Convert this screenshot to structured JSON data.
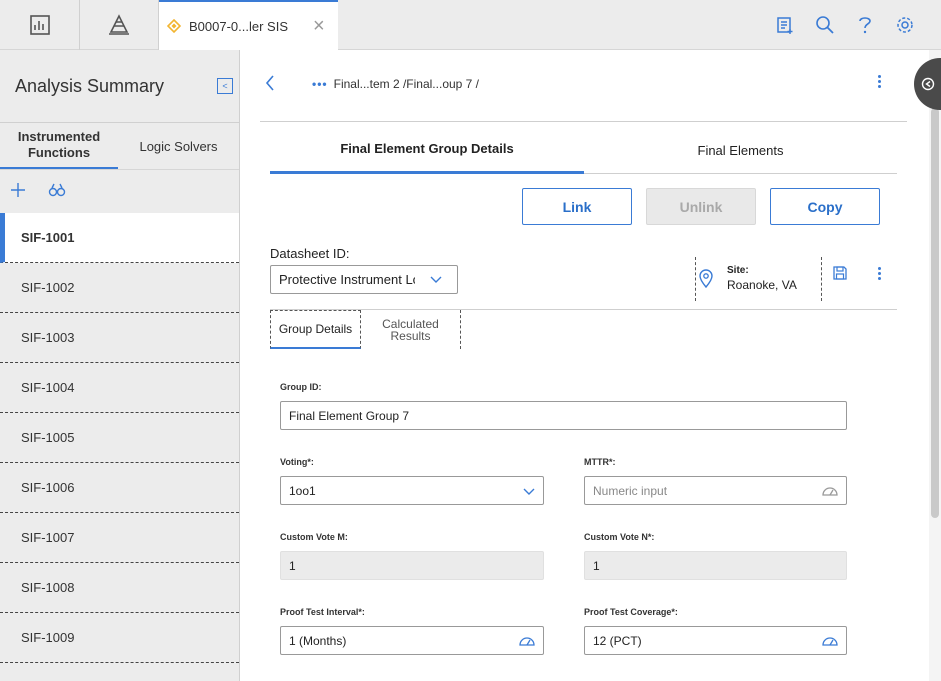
{
  "topbar": {
    "tab_label": "B0007-0...ler SIS",
    "tab_close": "×"
  },
  "left": {
    "title": "Analysis Summary",
    "tabs": [
      "Instrumented Functions",
      "Logic Solvers"
    ],
    "items": [
      "SIF-1001",
      "SIF-1002",
      "SIF-1003",
      "SIF-1004",
      "SIF-1005",
      "SIF-1006",
      "SIF-1007",
      "SIF-1008",
      "SIF-1009"
    ],
    "selected": "SIF-1001"
  },
  "main": {
    "breadcrumb": "Final...tem 2 /Final...oup 7 /",
    "tabs": [
      "Final Element Group Details",
      "Final Elements"
    ],
    "buttons": {
      "link": "Link",
      "unlink": "Unlink",
      "copy": "Copy"
    },
    "datasheet_label": "Datasheet ID:",
    "datasheet_value": "Protective Instrument Loop",
    "site_label": "Site:",
    "site_value": "Roanoke, VA",
    "subtabs": {
      "group_details": "Group Details",
      "calc_line1": "Calculated",
      "calc_line2": "Results"
    },
    "fields": {
      "group_id_label": "Group ID:",
      "group_id_value": "Final Element Group 7",
      "voting_label": "Voting*:",
      "voting_value": "1oo1",
      "mttr_label": "MTTR*:",
      "mttr_placeholder": "Numeric input",
      "vote_m_label": "Custom Vote M:",
      "vote_m_value": "1",
      "vote_n_label": "Custom Vote N*:",
      "vote_n_value": "1",
      "pti_label": "Proof Test Interval*:",
      "pti_value": "1 (Months)",
      "ptc_label": "Proof Test Coverage*:",
      "ptc_value": "12 (PCT)"
    }
  },
  "icons": [
    "dashboard-icon",
    "hierarchy-icon",
    "sif-tab-icon",
    "close-icon",
    "checklist-icon",
    "search-icon",
    "help-icon",
    "settings-icon",
    "collapse-icon",
    "add-icon",
    "binoculars-icon",
    "back-icon",
    "more-icon",
    "chevron-down-icon",
    "location-pin-icon",
    "save-icon",
    "gauge-icon",
    "panel-toggle-icon"
  ],
  "colors": {
    "accent": "#3a7bd5",
    "tab_icon": "#f2b531",
    "panel_bg": "#ececec"
  }
}
